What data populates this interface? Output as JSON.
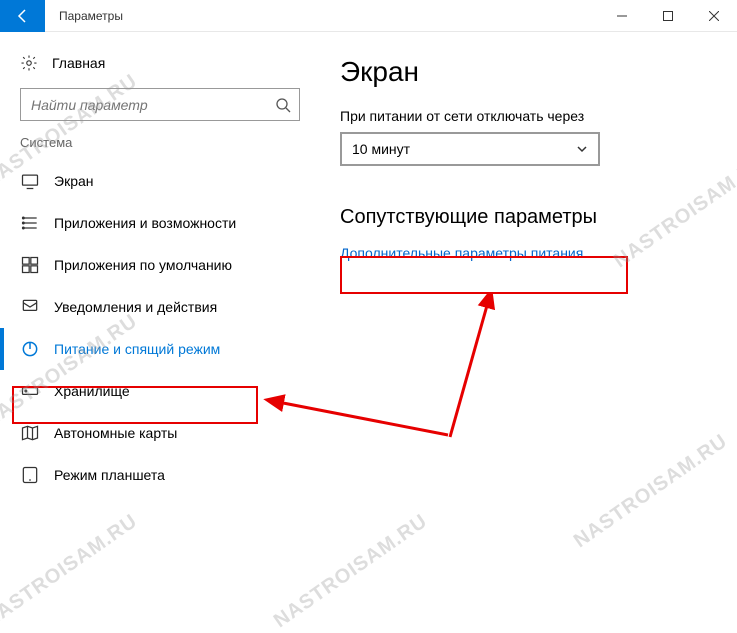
{
  "titlebar": {
    "title": "Параметры"
  },
  "sidebar": {
    "home_label": "Главная",
    "search_placeholder": "Найти параметр",
    "category": "Система",
    "items": [
      {
        "label": "Экран",
        "icon": "display-icon"
      },
      {
        "label": "Приложения и возможности",
        "icon": "apps-list-icon"
      },
      {
        "label": "Приложения по умолчанию",
        "icon": "default-apps-icon"
      },
      {
        "label": "Уведомления и действия",
        "icon": "notifications-icon"
      },
      {
        "label": "Питание и спящий режим",
        "icon": "power-icon"
      },
      {
        "label": "Хранилище",
        "icon": "storage-icon"
      },
      {
        "label": "Автономные карты",
        "icon": "offline-maps-icon"
      },
      {
        "label": "Режим планшета",
        "icon": "tablet-mode-icon"
      }
    ]
  },
  "content": {
    "page_title": "Экран",
    "plugged_in_label": "При питании от сети отключать через",
    "select_value": "10 минут",
    "related_heading": "Сопутствующие параметры",
    "related_link": "Дополнительные параметры питания"
  },
  "watermark_text": "NASTROISAM.RU",
  "annotations": {
    "arrow_color": "#e60000",
    "highlighted_sidebar_item": "Питание и спящий режим",
    "highlighted_link": "Дополнительные параметры питания"
  }
}
